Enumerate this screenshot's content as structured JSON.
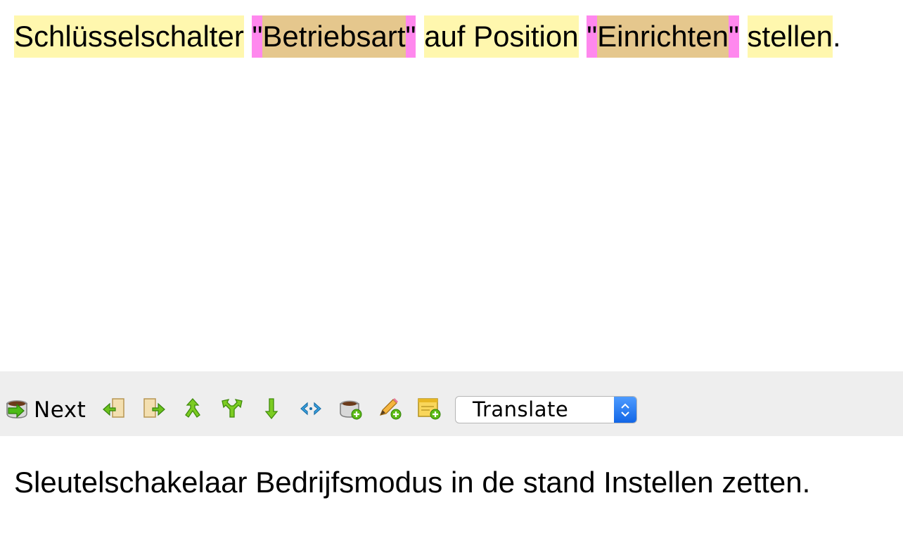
{
  "source": {
    "segments": [
      {
        "text": "Schlüsselschalter",
        "kind": "word"
      },
      {
        "text": " ",
        "kind": "plain"
      },
      {
        "text": "\"",
        "kind": "tag"
      },
      {
        "text": "Betriebsart",
        "kind": "term"
      },
      {
        "text": "\"",
        "kind": "tag"
      },
      {
        "text": " ",
        "kind": "plain"
      },
      {
        "text": "auf Position",
        "kind": "word"
      },
      {
        "text": " ",
        "kind": "plain"
      },
      {
        "text": "\"",
        "kind": "tag"
      },
      {
        "text": "Einrichten",
        "kind": "term"
      },
      {
        "text": "\"",
        "kind": "tag"
      },
      {
        "text": " ",
        "kind": "plain"
      },
      {
        "text": "stellen",
        "kind": "word"
      },
      {
        "text": ".",
        "kind": "plain"
      }
    ]
  },
  "toolbar": {
    "next_label": "Next",
    "icons": [
      "previous-segment-icon",
      "next-segment-icon",
      "merge-up-icon",
      "split-icon",
      "move-down-icon",
      "tag-code-icon",
      "add-term-icon",
      "edit-add-icon",
      "add-note-icon"
    ],
    "mode_select_value": "Translate"
  },
  "colors": {
    "word_highlight": "#fff7ae",
    "term_highlight": "#e5c78d",
    "tag_highlight": "#ff88ee",
    "toolbar_bg": "#eeeeee",
    "accent": "#1a73e8"
  },
  "target": {
    "text": "Sleutelschakelaar Bedrijfsmodus in de stand Instellen zetten."
  }
}
